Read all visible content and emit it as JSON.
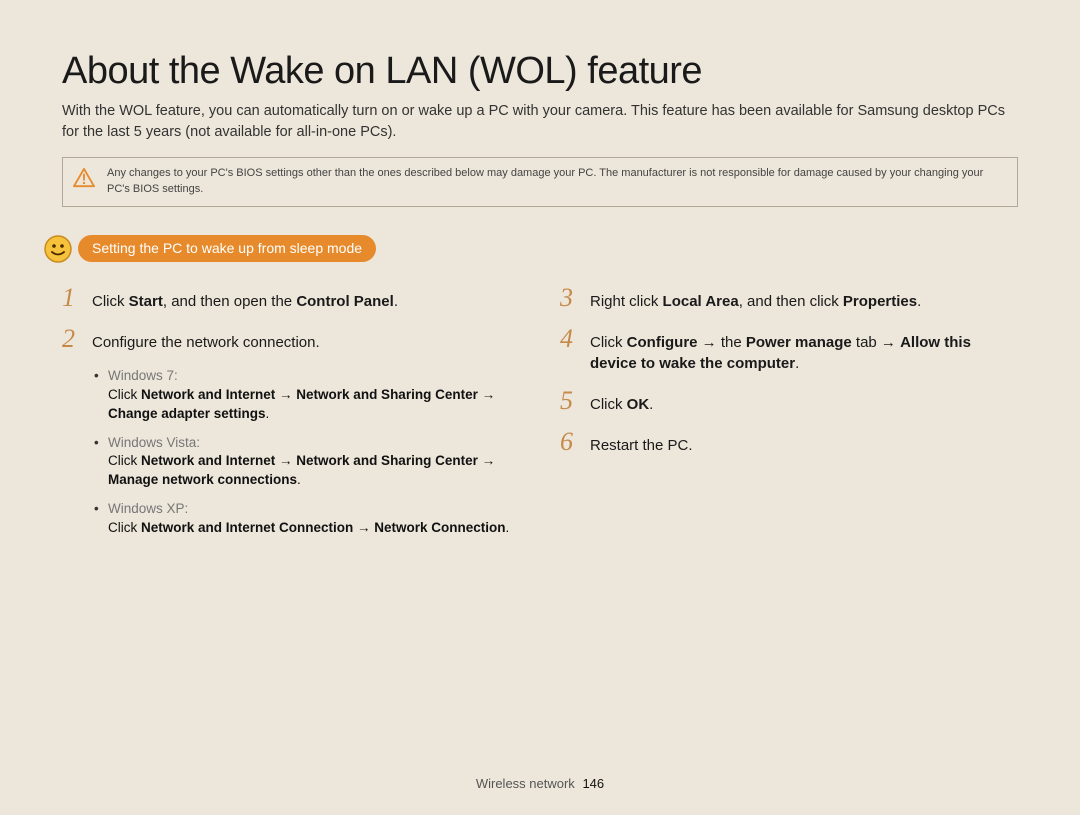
{
  "title": "About the Wake on LAN (WOL) feature",
  "intro": "With the WOL feature, you can automatically turn on or wake up a PC with your camera. This feature has been available for Samsung desktop PCs for the last 5 years (not available for all-in-one PCs).",
  "warning": "Any changes to your PC's BIOS settings other than the ones described below may damage your PC. The manufacturer is not responsible for damage caused by your changing your PC's BIOS settings.",
  "section_heading": "Setting the PC to wake up from sleep mode",
  "steps_left": {
    "s1": {
      "num": "1",
      "html": "Click <strong>Start</strong>, and then open the <strong>Control Panel</strong>."
    },
    "s2": {
      "num": "2",
      "html": "Configure the network connection.",
      "subs": {
        "a": {
          "os": "Windows 7:",
          "html": "Click <strong>Network and Internet</strong> → <strong>Network and Sharing Center</strong> → <strong>Change adapter settings</strong>."
        },
        "b": {
          "os": "Windows Vista:",
          "html": "Click <strong>Network and Internet</strong> → <strong>Network and Sharing Center</strong> → <strong>Manage network connections</strong>."
        },
        "c": {
          "os": "Windows XP:",
          "html": "Click <strong>Network and Internet Connection</strong> → <strong>Network Connection</strong>."
        }
      }
    }
  },
  "steps_right": {
    "s3": {
      "num": "3",
      "html": "Right click <strong>Local Area</strong>, and then click <strong>Properties</strong>."
    },
    "s4": {
      "num": "4",
      "html": "Click <strong>Configure</strong> → the <strong>Power manage</strong> tab → <strong>Allow this device to wake the computer</strong>."
    },
    "s5": {
      "num": "5",
      "html": "Click <strong>OK</strong>."
    },
    "s6": {
      "num": "6",
      "html": "Restart the PC."
    }
  },
  "footer": {
    "section": "Wireless network",
    "page": "146"
  }
}
